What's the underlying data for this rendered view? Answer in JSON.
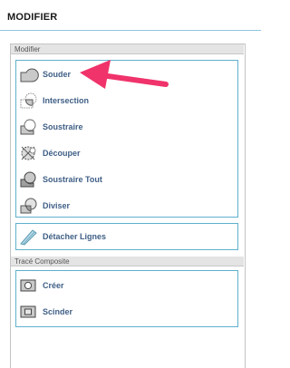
{
  "panel": {
    "title": "MODIFIER"
  },
  "sections": {
    "modifier": {
      "header": "Modifier",
      "buttons": [
        {
          "label": "Souder",
          "icon": "weld-icon"
        },
        {
          "label": "Intersection",
          "icon": "intersect-icon"
        },
        {
          "label": "Soustraire",
          "icon": "subtract-icon"
        },
        {
          "label": "Découper",
          "icon": "slice-icon"
        },
        {
          "label": "Soustraire Tout",
          "icon": "subtract-all-icon"
        },
        {
          "label": "Diviser",
          "icon": "divide-icon"
        }
      ],
      "detach": {
        "label": "Détacher Lignes",
        "icon": "detach-lines-icon"
      }
    },
    "compound": {
      "header": "Tracé Composite",
      "buttons": [
        {
          "label": "Créer",
          "icon": "make-compound-icon"
        },
        {
          "label": "Scinder",
          "icon": "release-compound-icon"
        }
      ]
    }
  },
  "colors": {
    "accent_border": "#5fb0cd",
    "label_text": "#3f5f86",
    "annotation_arrow": "#f0336b"
  }
}
